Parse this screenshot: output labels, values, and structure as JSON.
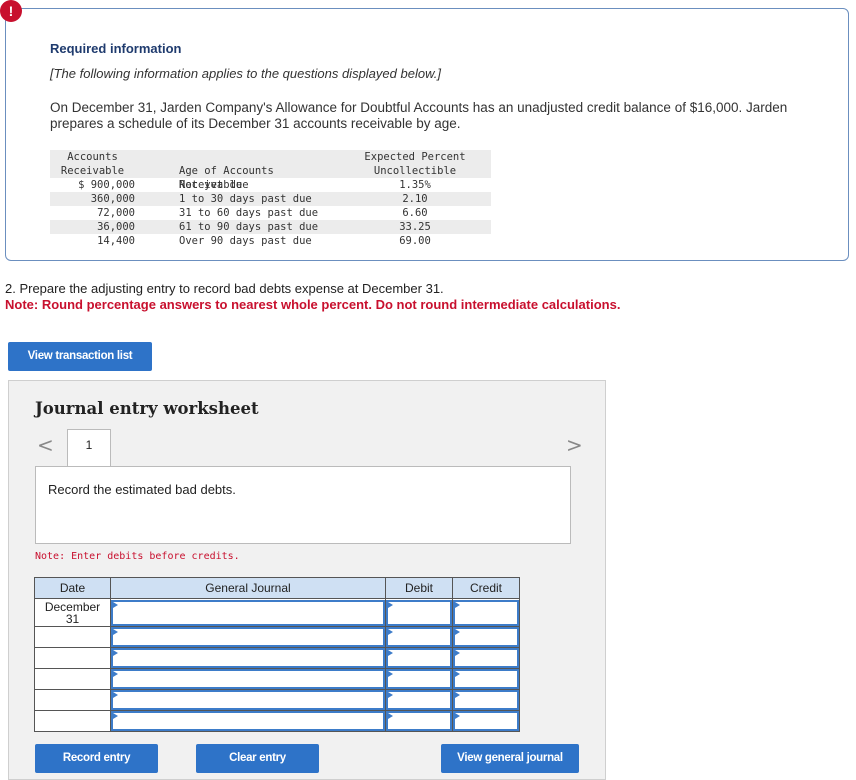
{
  "info": {
    "icon": "!",
    "title": "Required information",
    "note": "[The following information applies to the questions displayed below.]",
    "text": "On December 31, Jarden Company's Allowance for Doubtful Accounts has an unadjusted credit balance of $16,000. Jarden prepares a schedule of its December 31 accounts receivable by age."
  },
  "aging_table": {
    "headers": {
      "col1_line1": "Accounts",
      "col1_line2": "Receivable",
      "col2": "Age of Accounts Receivable",
      "col3_line1": "Expected Percent",
      "col3_line2": "Uncollectible"
    },
    "rows": [
      {
        "amount": "$ 900,000",
        "age": "Not yet due",
        "pct": "1.35%"
      },
      {
        "amount": "360,000",
        "age": "1 to 30 days past due",
        "pct": "2.10"
      },
      {
        "amount": "72,000",
        "age": "31 to 60 days past due",
        "pct": "6.60"
      },
      {
        "amount": "36,000",
        "age": "61 to 90 days past due",
        "pct": "33.25"
      },
      {
        "amount": "14,400",
        "age": "Over 90 days past due",
        "pct": "69.00"
      }
    ]
  },
  "question": {
    "text": "2. Prepare the adjusting entry to record bad debts expense at December 31.",
    "note": "Note: Round percentage answers to nearest whole percent. Do not round intermediate calculations."
  },
  "buttons": {
    "view_transaction_list": "View transaction list",
    "record_entry": "Record entry",
    "clear_entry": "Clear entry",
    "view_general_journal": "View general journal"
  },
  "worksheet": {
    "title": "Journal entry worksheet",
    "nav_prev": "<",
    "nav_next": ">",
    "tab_label": "1",
    "instruction": "Record the estimated bad debts.",
    "note": "Note: Enter debits before credits.",
    "columns": {
      "date": "Date",
      "journal": "General Journal",
      "debit": "Debit",
      "credit": "Credit"
    },
    "first_date_line1": "December",
    "first_date_line2": "31"
  },
  "colors": {
    "accent": "#2e73c8",
    "alert": "#c8102e",
    "header_bg": "#cfe0f3"
  }
}
